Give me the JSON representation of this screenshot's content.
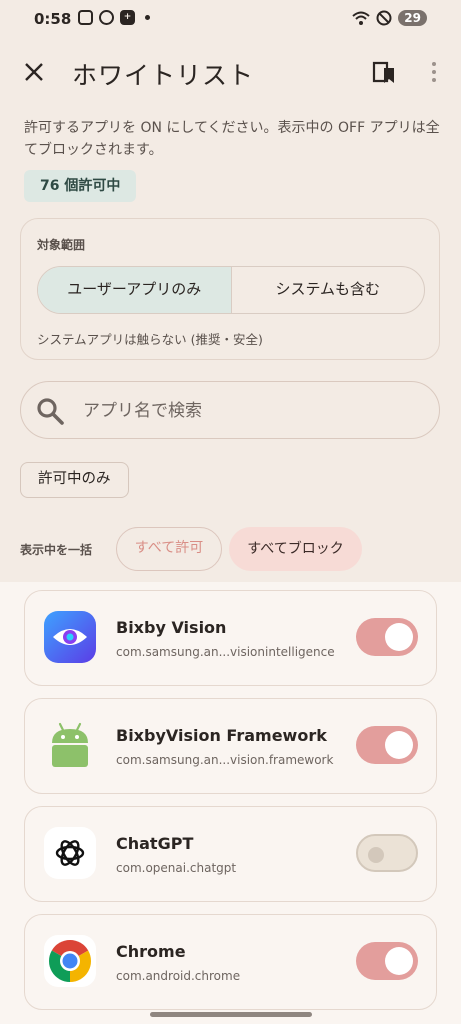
{
  "status_bar": {
    "time": "0:58",
    "battery": "29"
  },
  "app_bar": {
    "title": "ホワイトリスト",
    "close_icon": "close-icon",
    "bookmark_icon": "bookmark-icon",
    "more_icon": "more-vert-icon"
  },
  "intro_text": "許可するアプリを ON にしてください。表示中の OFF アプリは全てブロックされます。",
  "allowed_count": "76 個許可中",
  "scope": {
    "label": "対象範囲",
    "options": [
      "ユーザーアプリのみ",
      "システムも含む"
    ],
    "selected": "ユーザーアプリのみ",
    "note": "システムアプリは触らない (推奨・安全)"
  },
  "search": {
    "placeholder": "アプリ名で検索",
    "value": ""
  },
  "filter_chip": "許可中のみ",
  "bulk": {
    "label": "表示中を一括",
    "allow_all": "すべて許可",
    "block_all": "すべてブロック"
  },
  "apps": [
    {
      "name": "Bixby Vision",
      "package": "com.samsung.an...visionintelligence",
      "enabled": true,
      "icon": "bixby-vision-icon"
    },
    {
      "name": "BixbyVision Framework",
      "package": "com.samsung.an...vision.framework",
      "enabled": true,
      "icon": "android-icon"
    },
    {
      "name": "ChatGPT",
      "package": "com.openai.chatgpt",
      "enabled": false,
      "icon": "chatgpt-icon"
    },
    {
      "name": "Chrome",
      "package": "com.android.chrome",
      "enabled": true,
      "icon": "chrome-icon"
    }
  ],
  "colors": {
    "background": "#f3ebe4",
    "accent_teal": "#dde8e3",
    "toggle_on": "#e39e9c",
    "toggle_off": "#ebe2d6",
    "block_button": "#f7dbd6"
  }
}
